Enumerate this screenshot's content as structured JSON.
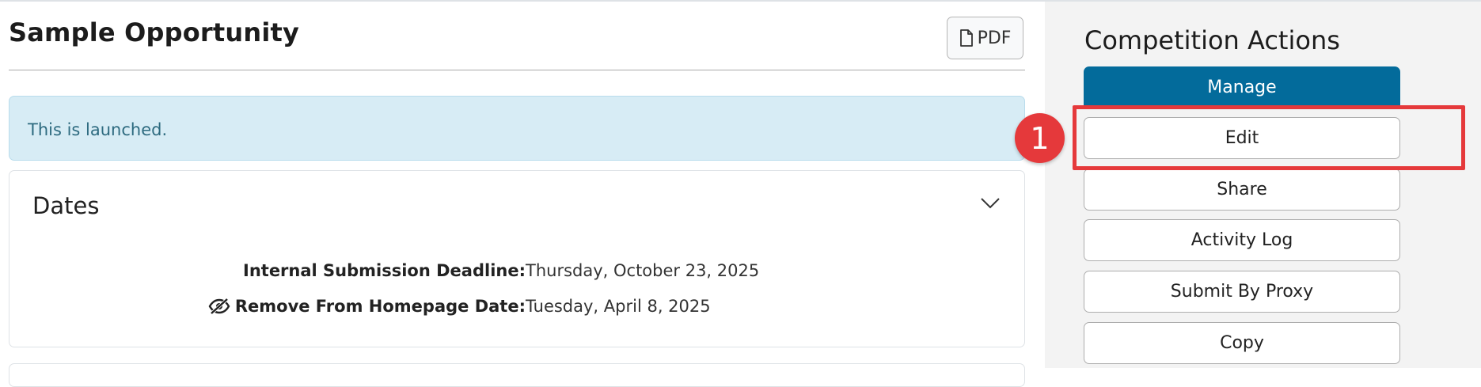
{
  "main": {
    "title": "Sample Opportunity",
    "pdf_label": "PDF",
    "alert_text": "This is launched.",
    "dates_card": {
      "title": "Dates",
      "rows": [
        {
          "label": "Internal Submission Deadline:",
          "value": "Thursday, October 23, 2025"
        },
        {
          "label": "Remove From Homepage Date:",
          "value": "Tuesday, April 8, 2025"
        }
      ]
    }
  },
  "sidebar": {
    "title": "Competition Actions",
    "actions": [
      "Manage",
      "Edit",
      "Share",
      "Activity Log",
      "Submit By Proxy",
      "Copy"
    ]
  },
  "annotation": {
    "step_number": "1"
  },
  "colors": {
    "primary": "#036b9b",
    "alert_bg": "#d7ecf5",
    "alert_text": "#2e6b80",
    "highlight": "#e5393b",
    "sidebar_bg": "#f3f3f3"
  },
  "icons": {
    "pdf": "file-icon",
    "collapse": "chevron-down-icon",
    "hidden": "eye-slash-icon"
  }
}
